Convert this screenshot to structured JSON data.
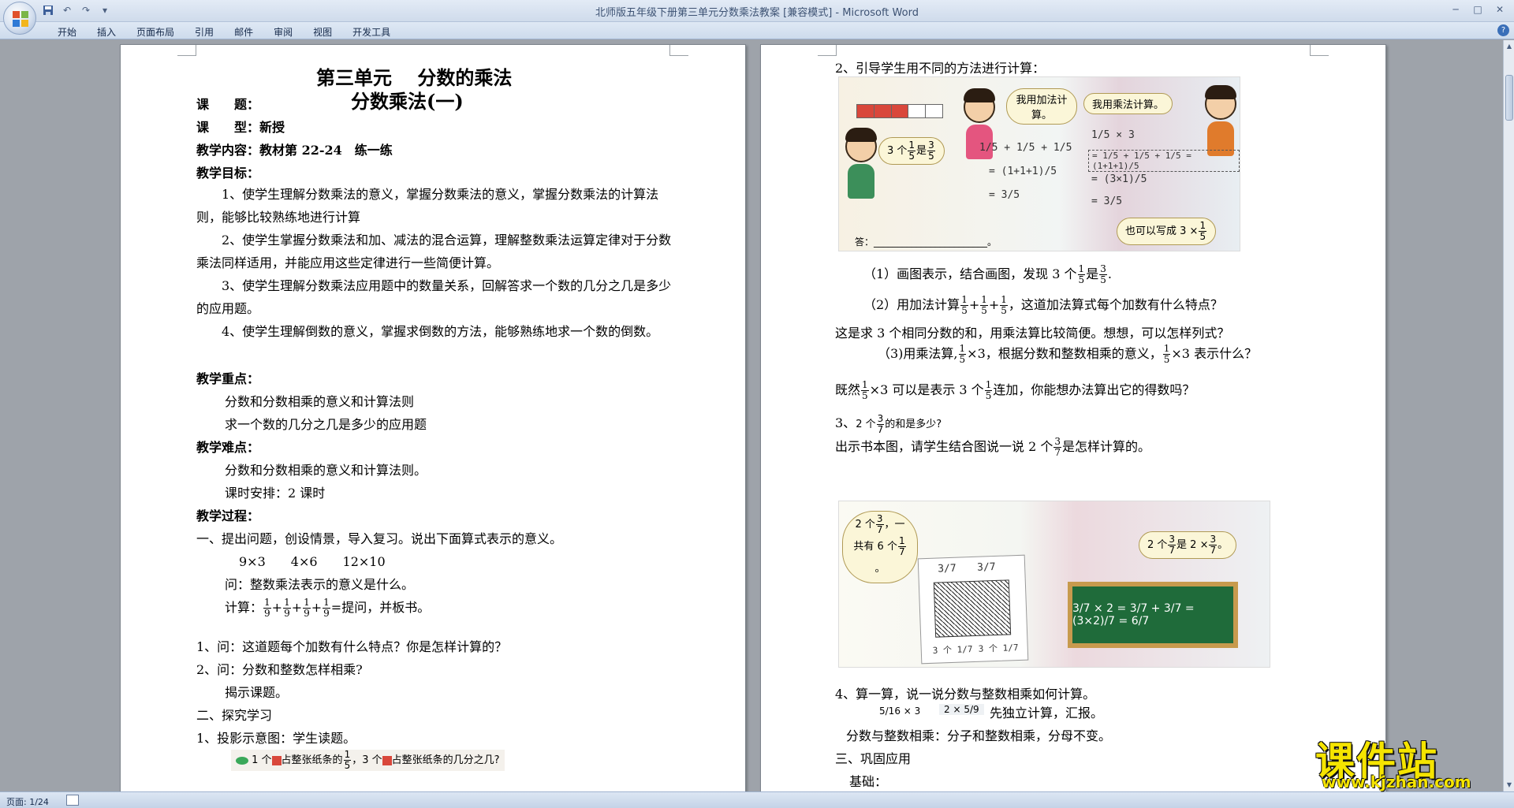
{
  "window": {
    "title": "北师版五年级下册第三单元分数乘法教案 [兼容模式] - Microsoft Word"
  },
  "ribbon": {
    "tabs": [
      "开始",
      "插入",
      "页面布局",
      "引用",
      "邮件",
      "审阅",
      "视图",
      "开发工具"
    ]
  },
  "status": {
    "page": "页面: 1/24"
  },
  "left_page": {
    "title": "第三单元　 分数的乘法",
    "lesson_label": "课　　题：",
    "lesson_name": "分数乘法(一)",
    "type_line": "课　　型：新授",
    "content_line": "教学内容：教材第 22-24　练一练",
    "goals_head": "教学目标：",
    "goal1": "1、使学生理解分数乘法的意义，掌握分数乘法的意义，掌握分数乘法的计算法则，能够比较熟练地进行计算",
    "goal2": "2、使学生掌握分数乘法和加、减法的混合运算，理解整数乘法运算定律对于分数乘法同样适用，并能应用这些定律进行一些简便计算。",
    "goal3": "3、使学生理解分数乘法应用题中的数量关系，回解答求一个数的几分之几是多少的应用题。",
    "goal4": "4、使学生理解倒数的意义，掌握求倒数的方法，能够熟练地求一个数的倒数。",
    "key_head": "教学重点：",
    "key1": "分数和分数相乘的意义和计算法则",
    "key2": "求一个数的几分之几是多少的应用题",
    "diff_head": "教学难点：",
    "diff1": "分数和分数相乘的意义和计算法则。",
    "schedule": "课时安排：2 课时",
    "process_head": "教学过程：",
    "p1": "一、提出问题，创设情景，导入复习。说出下面算式表示的意义。",
    "p1_exprs": "9×3　　4×6　　12×10",
    "p1_q": "问：整数乘法表示的意义是什么。",
    "calc_label": "计算：",
    "calc_num": "1",
    "calc_den": "9",
    "calc_plus": "+",
    "calc_tail": "=提问，并板书。",
    "q1": "1、问：这道题每个加数有什么特点？你是怎样计算的？",
    "q2": "2、问：分数和整数怎样相乘?",
    "reveal": "揭示课题。",
    "explore": "二、探究学习",
    "project": "1、投影示意图：学生读题。",
    "caption_a": "1 个",
    "caption_b": "占整张纸条的",
    "caption_c": "，3 个",
    "caption_d": "占整张纸条的几分之几?",
    "caption_num": "1",
    "caption_den": "5"
  },
  "right_page": {
    "guide": "2、引导学生用不同的方法进行计算：",
    "bubble_add": "我用加法计算。",
    "bubble_mul": "我用乘法计算。",
    "bubble_three_a": "3 个",
    "bubble_three_b": "是",
    "bubble_also": "也可以写成 3 ×",
    "answer_label": "答：",
    "answer_blank": "________________________。",
    "frac_1_5_num": "1",
    "frac_1_5_den": "5",
    "frac_3_5_num": "3",
    "frac_3_5_den": "5",
    "hand_add_line1": "1/5 + 1/5 + 1/5",
    "hand_add_line2": "= (1+1+1)/5",
    "hand_add_line3": "= 3/5",
    "hand_mul_line1": "1/5 × 3",
    "hand_mul_line2": "= 1/5 + 1/5 + 1/5 = (1+1+1)/5",
    "hand_mul_line3": "= (3×1)/5",
    "hand_mul_line4": "= 3/5",
    "s1_a": "（1）画图表示，结合画图，发现 3 个",
    "s1_b": "是",
    "s1_c": ".",
    "s2_a": "（2）用加法计算",
    "s2_b": "，这道加法算式每个加数有什么特点？",
    "s2_plus": "+",
    "s2_cont": "这是求 3 个相同分数的和，用乘法算比较简便。想想，可以怎样列式？",
    "s3_a": "（3)用乘法算,",
    "s3_b": "×3，根据分数和整数相乘的意义，",
    "s3_c": "×3 表示什么？",
    "s4_a": "既然",
    "s4_b": "×3 可以是表示 3 个",
    "s4_c": "连加，你能想办法算出它的得数吗？",
    "t3_a": "3、",
    "t3_b": "2 个",
    "t3_c": "的和是多少?",
    "frac_3_7_num": "3",
    "frac_3_7_den": "7",
    "frac_1_7_num": "1",
    "frac_1_7_den": "7",
    "show_a": "出示书本图，请学生结合图说一说 2 个",
    "show_b": "是怎样计算的。",
    "bubble_two_a": "2 个",
    "bubble_two_b": "，一共有 6 个",
    "bubble_two_c": "。",
    "bubble_eq_a": "2 个",
    "bubble_eq_b": "是 2 ×",
    "bubble_eq_c": "。",
    "board_text": "3/7 × 2 = 3/7 + 3/7 = (3×2)/7 = 6/7",
    "strip_label_a": "3 个 1/7",
    "strip_label_b": "3 个 1/7",
    "strip_top_a": "3/7",
    "strip_top_b": "3/7",
    "t4": "4、算一算，说一说分数与整数相乘如何计算。",
    "t4_expr1": "5/16 × 3",
    "t4_expr2": "2 × 5/9",
    "t4_tail": "先独立计算，汇报。",
    "rule": "分数与整数相乘：分子和整数相乘，分母不变。",
    "consolidate": "三、巩固应用",
    "basic": "基础："
  },
  "watermark": {
    "main": "课件站",
    "sub": "www.kjzhan.com"
  }
}
